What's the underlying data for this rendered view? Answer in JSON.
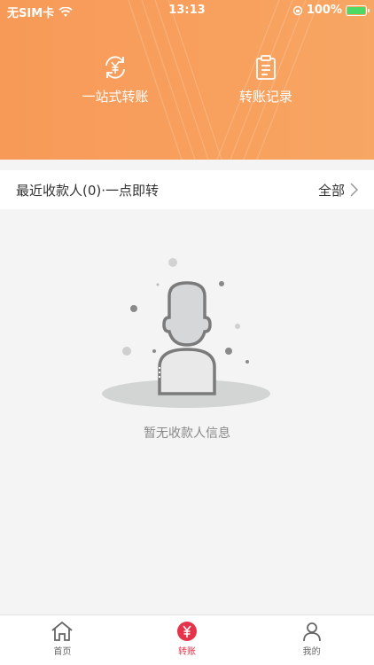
{
  "status_bar": {
    "carrier": "无SIM卡",
    "time": "13:13",
    "battery": "100%"
  },
  "header": {
    "actions": [
      {
        "label": "一站式转账",
        "icon": "transfer-cycle-icon"
      },
      {
        "label": "转账记录",
        "icon": "clipboard-record-icon"
      }
    ]
  },
  "recent": {
    "title": "最近收款人(0)·一点即转",
    "all_label": "全部"
  },
  "empty_state": {
    "message": "暂无收款人信息",
    "icon": "person-placeholder-icon"
  },
  "tabbar": {
    "tabs": [
      {
        "label": "首页",
        "icon": "home-icon",
        "active": false
      },
      {
        "label": "转账",
        "icon": "yuan-transfer-icon",
        "active": true
      },
      {
        "label": "我的",
        "icon": "person-icon",
        "active": false
      }
    ]
  },
  "colors": {
    "header": "#f79a58",
    "active_tab": "#e5344a"
  }
}
